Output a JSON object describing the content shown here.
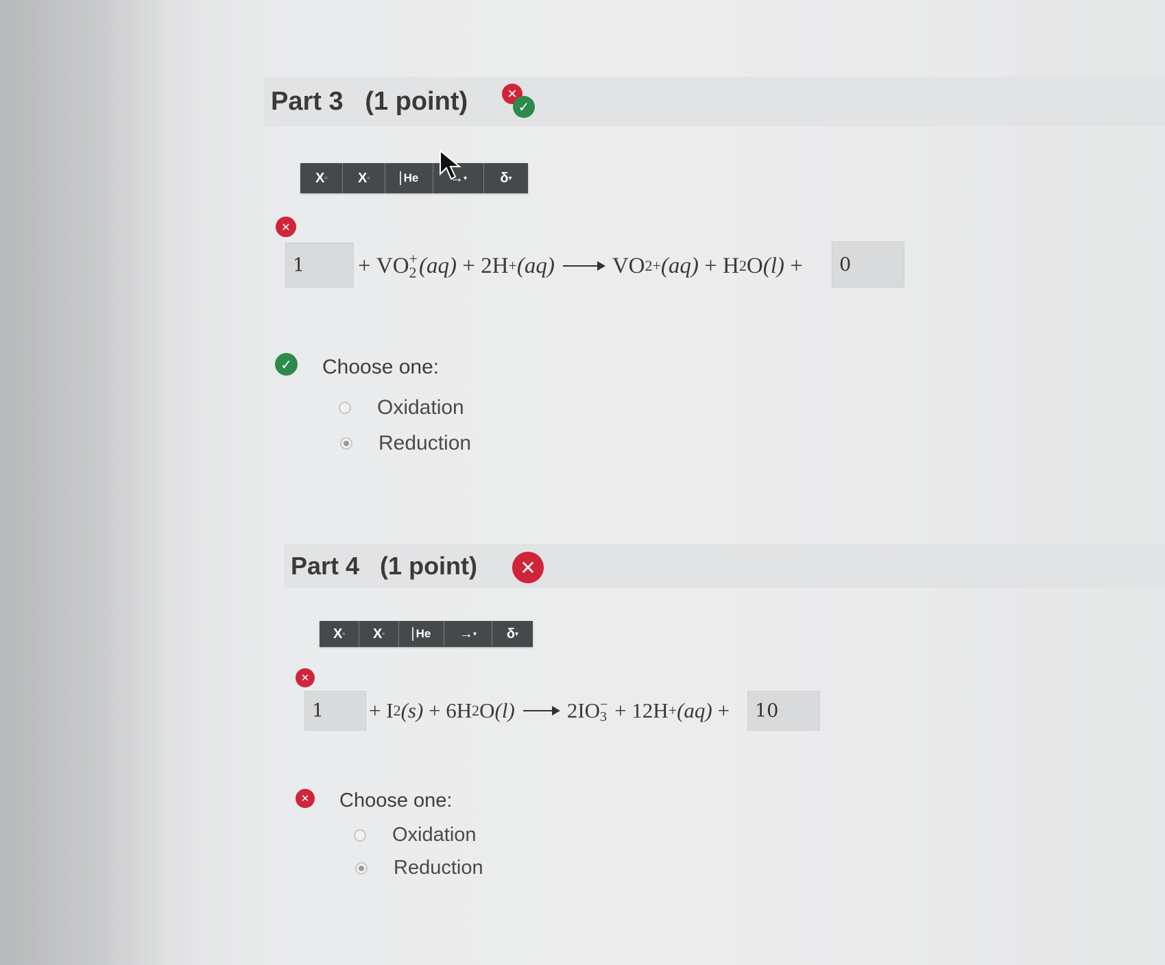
{
  "part3": {
    "title": "Part 3   (1 point)",
    "toolbar": {
      "superscript_label": "X",
      "subscript_label": "X",
      "element_label": "He",
      "arrow_label": "→",
      "delta_label": "δ"
    },
    "equation": {
      "input_left_value": "1",
      "plus1": "+",
      "species1": "VO",
      "species1_sub": "2",
      "species1_sup": "+",
      "state1": "(aq)",
      "plus2": "+",
      "species2": "2H",
      "species2_sup": "+",
      "state2": "(aq)",
      "product1": "VO",
      "product1_sup": "2+",
      "state3": "(aq)",
      "plus3": "+",
      "product2_a": "H",
      "product2_sub": "2",
      "product2_b": "O",
      "state4": "(l)",
      "plus4": "+",
      "input_right_value": "0"
    },
    "choose_label": "Choose one:",
    "options": [
      "Oxidation",
      "Reduction"
    ],
    "selected_option": "Reduction"
  },
  "part4": {
    "title": "Part 4   (1 point)",
    "toolbar": {
      "superscript_label": "X",
      "subscript_label": "X",
      "element_label": "He",
      "arrow_label": "→",
      "delta_label": "δ"
    },
    "equation": {
      "input_left_value": "1",
      "plus1": "+",
      "species1": "I",
      "species1_sub": "2",
      "state1": "(s)",
      "plus2": "+",
      "species2_a": "6H",
      "species2_sub": "2",
      "species2_b": "O",
      "state2": "(l)",
      "product1": "2IO",
      "product1_sub": "3",
      "product1_sup": "−",
      "plus3": "+",
      "product2": "12H",
      "product2_sup": "+",
      "state3": "(aq)",
      "plus4": "+",
      "input_right_value": "10"
    },
    "choose_label": "Choose one:",
    "options": [
      "Oxidation",
      "Reduction"
    ],
    "selected_option": "Reduction"
  },
  "colors": {
    "incorrect": "#d0243a",
    "correct": "#2d8a4a",
    "toolbar": "#45494c"
  }
}
